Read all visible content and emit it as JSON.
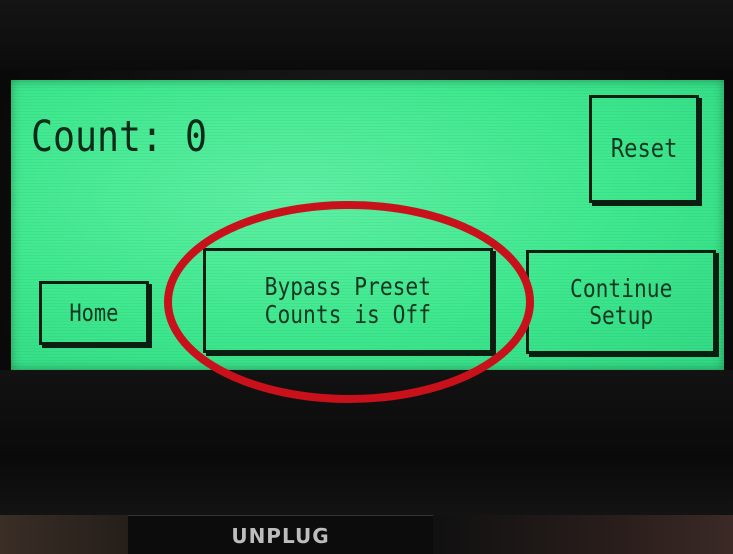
{
  "screen": {
    "count_label": "Count: 0",
    "buttons": {
      "reset": "Reset",
      "home": "Home",
      "bypass": "Bypass Preset\nCounts is Off",
      "continue": "Continue\nSetup"
    }
  },
  "bezel": {
    "unplug_label": "UNPLUG"
  },
  "colors": {
    "screen_green": "#3ee88e",
    "text_dark": "#0b2a18",
    "highlight_red": "#c8111a"
  }
}
